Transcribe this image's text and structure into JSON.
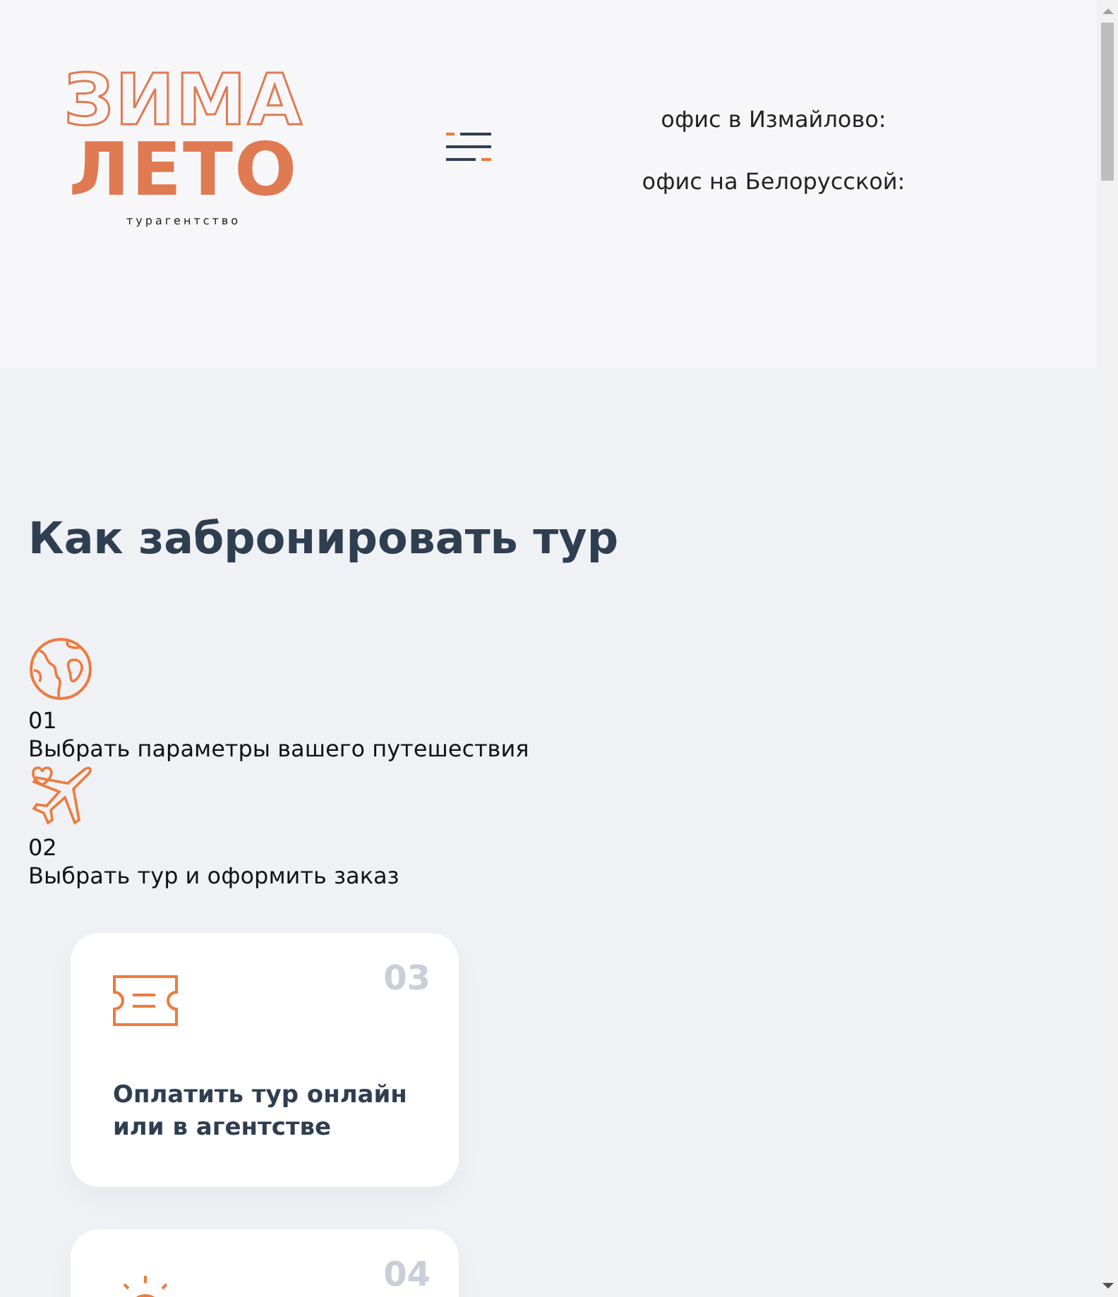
{
  "header": {
    "logo": {
      "top": "ЗИМА",
      "bottom": "ЛЕТО",
      "tagline": "турагентство"
    },
    "offices": [
      "офис в Измайлово:",
      "офис на Белорусской:"
    ]
  },
  "section": {
    "title": "Как забронировать тур",
    "steps": [
      {
        "kind": "plain",
        "number": "01",
        "text": "Выбрать параметры вашего путешествия"
      },
      {
        "kind": "plain",
        "number": "02",
        "text": "Выбрать тур и оформить заказ"
      },
      {
        "kind": "card",
        "number": "03",
        "text": "Оплатить тур онлайн или в агентстве"
      },
      {
        "kind": "card",
        "number": "04"
      }
    ]
  }
}
